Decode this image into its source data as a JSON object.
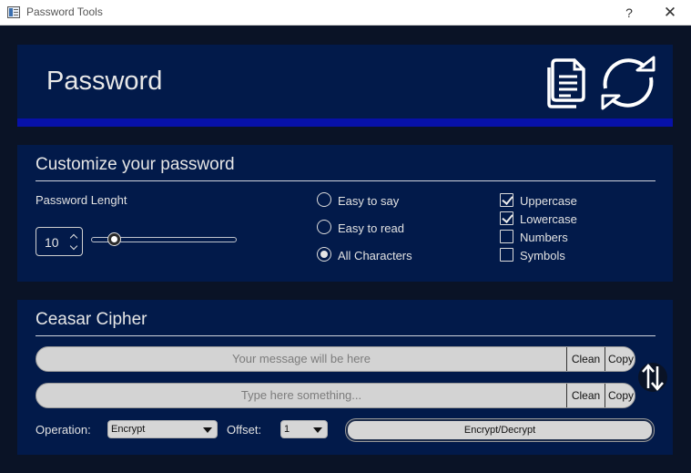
{
  "window": {
    "title": "Password Tools",
    "help_label": "?",
    "close_label": "✕"
  },
  "header": {
    "title": "Password",
    "icons": [
      "copy-icon",
      "refresh-icon"
    ]
  },
  "customize": {
    "title": "Customize your password",
    "length_label": "Password Lenght",
    "length_value": "10",
    "slider": {
      "value": 10,
      "min": 4,
      "max": 50
    },
    "modes": [
      {
        "label": "Easy to say",
        "checked": false
      },
      {
        "label": "Easy to read",
        "checked": false
      },
      {
        "label": "All Characters",
        "checked": true
      }
    ],
    "options": [
      {
        "label": "Uppercase",
        "checked": true
      },
      {
        "label": "Lowercase",
        "checked": true
      },
      {
        "label": "Numbers",
        "checked": false
      },
      {
        "label": "Symbols",
        "checked": false
      }
    ]
  },
  "cipher": {
    "title": "Ceasar Cipher",
    "output_placeholder": "Your message will be here",
    "input_placeholder": "Type here something...",
    "clean_label": "Clean",
    "copy_label": "Copy",
    "operation_label": "Operation:",
    "operation_value": "Encrypt",
    "offset_label": "Offset:",
    "offset_value": "1",
    "action_label": "Encrypt/Decrypt"
  },
  "colors": {
    "background": "#0a1326",
    "panel": "#021a4a",
    "accent_bar": "#0711a8",
    "field": "#d3d3d3"
  }
}
